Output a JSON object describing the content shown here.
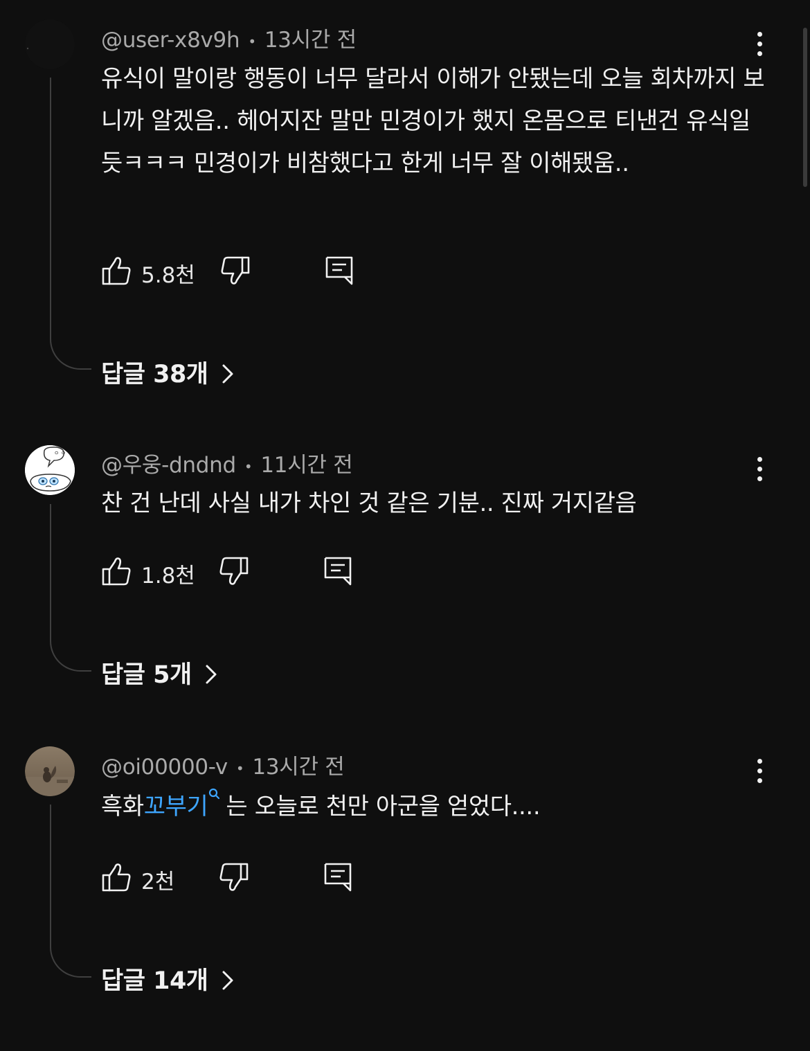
{
  "comments": [
    {
      "author": "@user-x8v9h",
      "time": "13시간 전",
      "text": "유식이 말이랑 행동이 너무 달라서 이해가 안됐는데 오늘 회차까지 보니까 알겠음.. 헤어지잔 말만 민경이가 했지 온몸으로 티낸건 유식일듯ㅋㅋㅋ 민경이가 비참했다고 한게 너무 잘 이해됐움..",
      "likes": "5.8천",
      "replies": "답글 38개"
    },
    {
      "author": "@우웅-dndnd",
      "time": "11시간 전",
      "text": "찬 건 난데 사실 내가 차인 것 같은 기분.. 진짜 거지같음",
      "likes": "1.8천",
      "replies": "답글 5개"
    },
    {
      "author": "@oi00000-v",
      "time": "13시간 전",
      "text_before": "흑화",
      "hashtag": "꼬부기",
      "text_after": "는 오늘로 천만 아군을 얻었다....",
      "likes": "2천",
      "replies": "답글 14개"
    }
  ],
  "icons": {
    "like": "thumbs-up-icon",
    "dislike": "thumbs-down-icon",
    "reply": "reply-comment-icon",
    "more": "more-vertical-icon",
    "chevron": "chevron-right-icon"
  },
  "colors": {
    "background": "#0f0f0f",
    "text": "#f1f1f1",
    "secondary": "#aaaaaa",
    "link": "#3ea6ff"
  }
}
